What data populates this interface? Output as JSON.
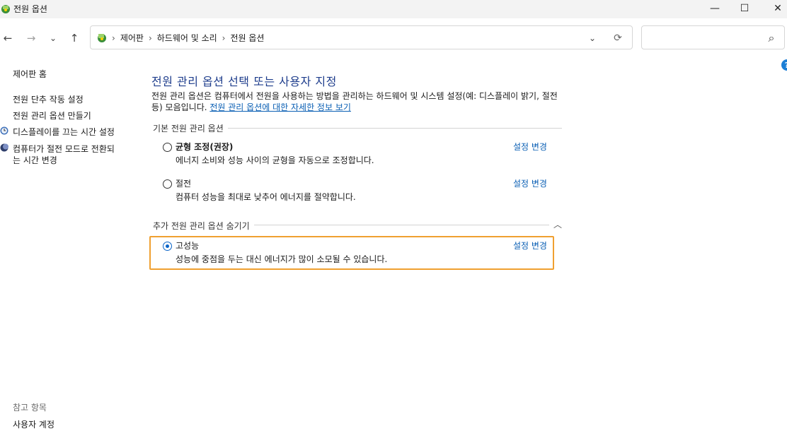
{
  "window": {
    "title": "전원 옵션",
    "minimize_glyph": "—",
    "maximize_glyph": "☐",
    "close_glyph": "✕"
  },
  "nav": {
    "back_glyph": "←",
    "forward_glyph": "→",
    "recent_glyph": "⌄",
    "up_glyph": "↑",
    "refresh_glyph": "⟳",
    "dropdown_glyph": "⌄",
    "search_glyph": "⌕"
  },
  "address": {
    "breadcrumbs": [
      "제어판",
      "하드웨어 및 소리",
      "전원 옵션"
    ],
    "separator": "›",
    "lead_separator": "›"
  },
  "sidebar": {
    "home": "제어판 홈",
    "links": [
      {
        "label": "전원 단추 작동 설정"
      },
      {
        "label": "전원 관리 옵션 만들기"
      },
      {
        "label": "디스플레이를 끄는 시간 설정",
        "icon": "clock-icon"
      },
      {
        "label_line1": "컴퓨터가 절전 모드로 전환되",
        "label_line2": "는 시간 변경",
        "icon": "moon-icon"
      }
    ],
    "see_also": {
      "heading": "참고 항목",
      "user_accounts": "사용자 계정"
    }
  },
  "main": {
    "title": "전원 관리 옵션 선택 또는 사용자 지정",
    "description": "전원 관리 옵션은 컴퓨터에서 전원을 사용하는 방법을 관리하는 하드웨어 및 시스템 설정(예: 디스플레이 밝기, 절전 등) 모음입니다. ",
    "info_link": "전원 관리 옵션에 대한 자세한 정보 보기",
    "basic_section": "기본 전원 관리 옵션",
    "additional_section": "추가 전원 관리 옵션 숨기기",
    "collapse_glyph": "︿",
    "help_glyph": "?",
    "plans": [
      {
        "name": "균형 조정(권장)",
        "desc": "에너지 소비와 성능 사이의 균형을 자동으로 조정합니다.",
        "change": "설정 변경",
        "selected": false
      },
      {
        "name": "절전",
        "desc": "컴퓨터 성능을 최대로 낮추어 에너지를 절약합니다.",
        "change": "설정 변경",
        "selected": false
      },
      {
        "name": "고성능",
        "desc": "성능에 중점을 두는 대신 에너지가 많이 소모될 수 있습니다.",
        "change": "설정 변경",
        "selected": true
      }
    ]
  },
  "colors": {
    "title_blue": "#1e3d8c",
    "link_blue": "#0a5fb4",
    "selection_orange": "#f0a030",
    "radio_blue": "#0a64c8"
  }
}
